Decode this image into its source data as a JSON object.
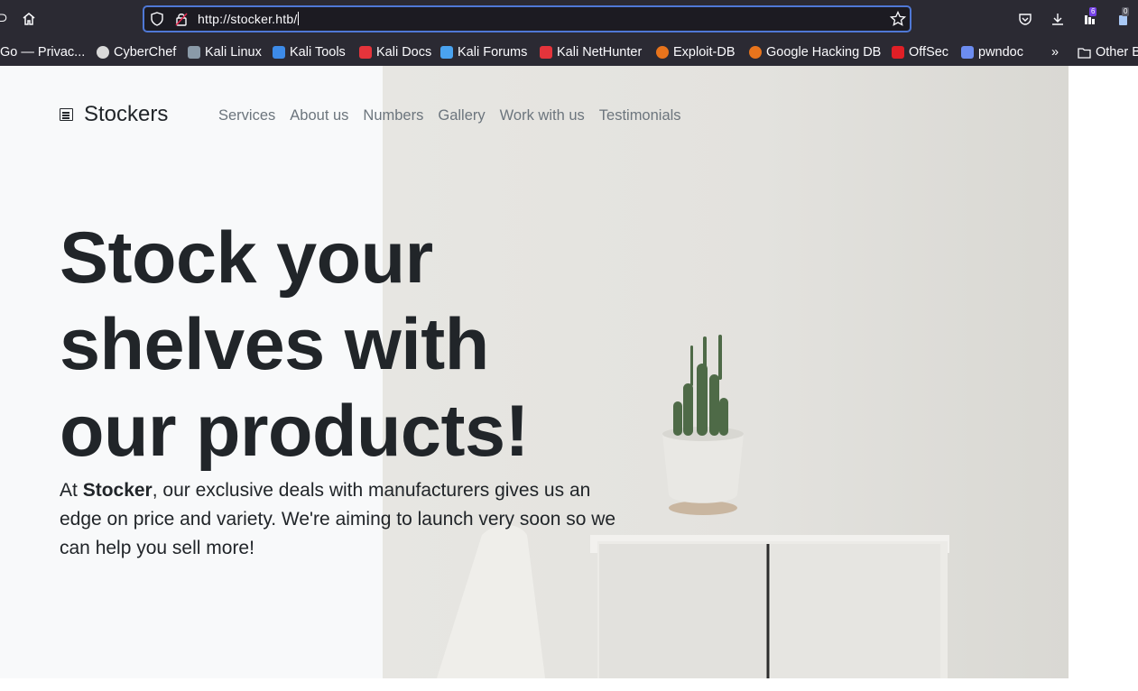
{
  "browser": {
    "url": "http://stocker.htb/",
    "icons": {
      "back": "back-arrow-icon",
      "home": "home-icon",
      "shield": "shield-icon",
      "lock": "insecure-lock-icon",
      "star": "bookmark-star-icon",
      "pocket": "pocket-icon",
      "download": "download-icon",
      "extension1": "extension-icon",
      "extension2": "extension-icon-2",
      "overflow": "chevron-double-right-icon",
      "folder": "folder-icon"
    },
    "badges": {
      "extension1": "6",
      "extension2": "0"
    },
    "bookmarks": [
      {
        "label": "Go — Privac...",
        "color": "#2b2a33"
      },
      {
        "label": "CyberChef",
        "color": "#d9d9d9"
      },
      {
        "label": "Kali Linux",
        "color": "#8a9aa8"
      },
      {
        "label": "Kali Tools",
        "color": "#3d8be8"
      },
      {
        "label": "Kali Docs",
        "color": "#e5343b"
      },
      {
        "label": "Kali Forums",
        "color": "#4aa3f0"
      },
      {
        "label": "Kali NetHunter",
        "color": "#e5343b"
      },
      {
        "label": "Exploit-DB",
        "color": "#e8741c"
      },
      {
        "label": "Google Hacking DB",
        "color": "#e8741c"
      },
      {
        "label": "OffSec",
        "color": "#e01f26"
      },
      {
        "label": "pwndoc",
        "color": "#6c8cf0"
      }
    ],
    "other_bookmarks": "Other B"
  },
  "site": {
    "brand": "Stockers",
    "nav": [
      "Services",
      "About us",
      "Numbers",
      "Gallery",
      "Work with us",
      "Testimonials"
    ],
    "headline": "Stock your shelves with our products!",
    "lead_prefix": "At ",
    "lead_bold": "Stocker",
    "lead_rest": ", our exclusive deals with manufacturers gives us an edge on price and variety. We're aiming to launch very soon so we can help you sell more!"
  }
}
